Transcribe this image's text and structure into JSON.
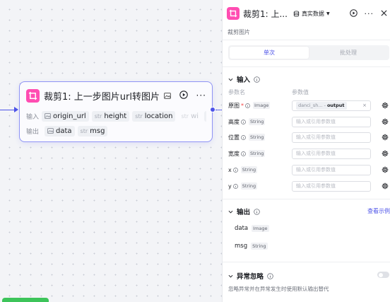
{
  "node": {
    "title": "裁剪1: 上一步图片url转图片",
    "inputs_label": "输入",
    "outputs_label": "输出",
    "inputs": [
      {
        "kind": "img",
        "name": "origin_url"
      },
      {
        "kind": "str",
        "name": "height"
      },
      {
        "kind": "str",
        "name": "location"
      },
      {
        "kind": "str",
        "name": "wi"
      }
    ],
    "outputs": [
      {
        "kind": "img",
        "name": "data"
      },
      {
        "kind": "str",
        "name": "msg"
      }
    ],
    "type_prefix": "str",
    "more": "···"
  },
  "panel": {
    "title": "裁剪1: 上...",
    "data_tag": "真实数据",
    "subtitle": "裁剪图片",
    "tabs": [
      {
        "label": "单次",
        "active": true
      },
      {
        "label": "批处理",
        "active": false
      }
    ],
    "input_section": {
      "title": "输入",
      "col_name": "参数名",
      "col_value": "参数值",
      "params": [
        {
          "name": "原图",
          "required": true,
          "type": "Image",
          "ref_source": "danci_sh...",
          "ref_sep": "-",
          "ref_field": "output",
          "placeholder": ""
        },
        {
          "name": "高度",
          "required": false,
          "type": "String",
          "placeholder": "输入或引用参数值"
        },
        {
          "name": "位置",
          "required": false,
          "type": "String",
          "placeholder": "输入或引用参数值"
        },
        {
          "name": "宽度",
          "required": false,
          "type": "String",
          "placeholder": "输入或引用参数值"
        },
        {
          "name": "x",
          "required": false,
          "type": "String",
          "placeholder": "输入或引用参数值"
        },
        {
          "name": "y",
          "required": false,
          "type": "String",
          "placeholder": "输入或引用参数值"
        }
      ]
    },
    "output_section": {
      "title": "输出",
      "link": "查看示例",
      "items": [
        {
          "name": "data",
          "type": "Image"
        },
        {
          "name": "msg",
          "type": "String"
        }
      ]
    },
    "exception_section": {
      "title": "异常忽略",
      "description": "忽略异常并在异常发生时使用默认输出替代",
      "enabled": false
    }
  },
  "colors": {
    "accent": "#4d53e8",
    "node_icon": "#ff4db2",
    "required": "#f53f3f",
    "run_button": "#3dc45a"
  }
}
